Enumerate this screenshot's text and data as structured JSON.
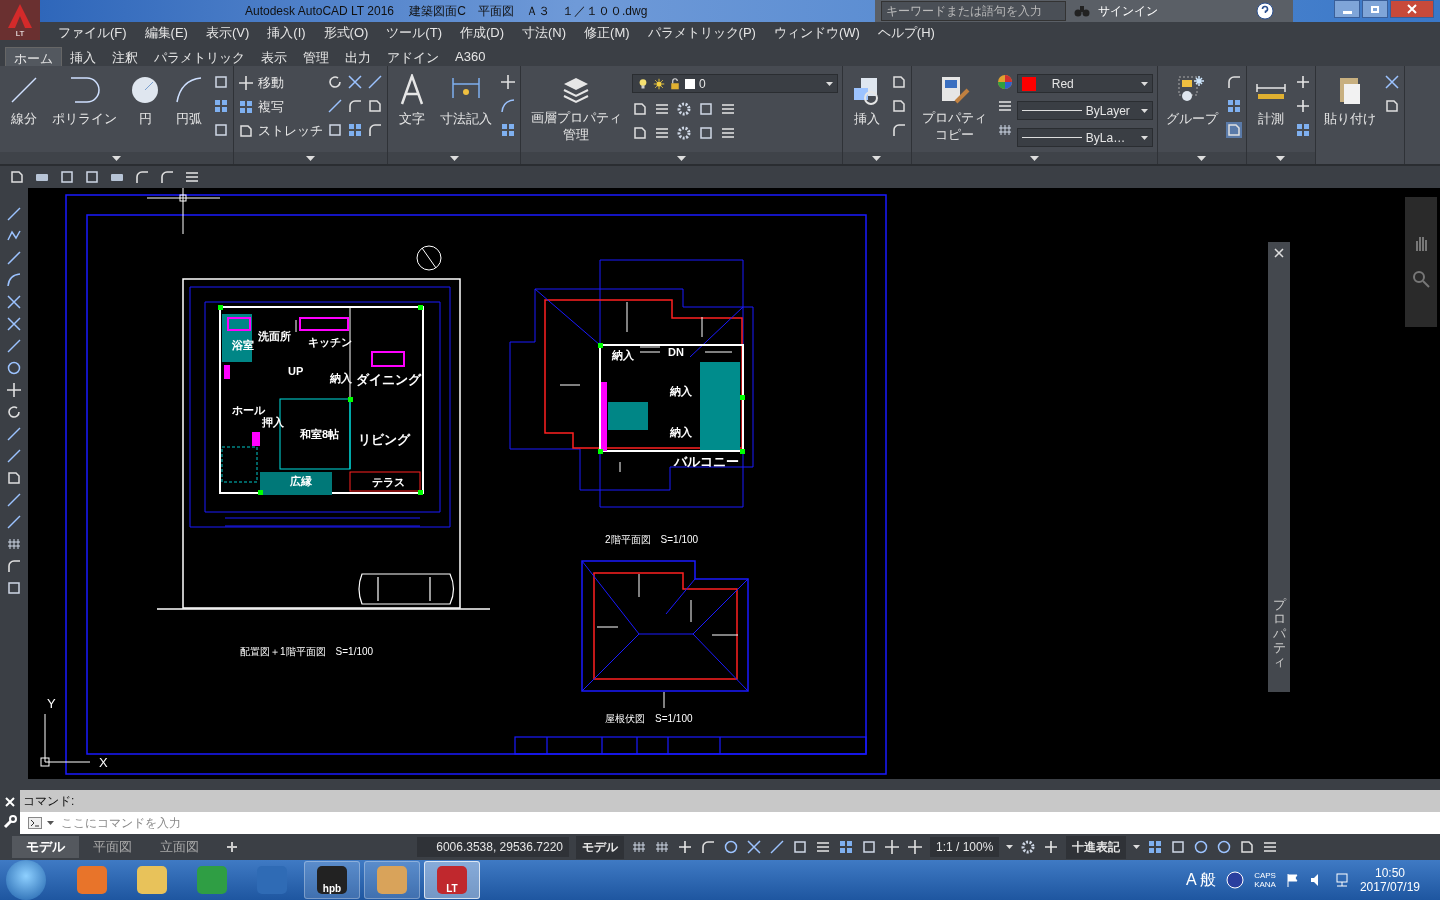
{
  "window": {
    "title": "Autodesk AutoCAD LT 2016　 建築図面C　平面図　Ａ３　１／１００.dwg",
    "app_badge": "LT"
  },
  "search": {
    "placeholder": "キーワードまたは語句を入力"
  },
  "sign_in": "サインイン",
  "menus": [
    "ファイル(F)",
    "編集(E)",
    "表示(V)",
    "挿入(I)",
    "形式(O)",
    "ツール(T)",
    "作成(D)",
    "寸法(N)",
    "修正(M)",
    "パラメトリック(P)",
    "ウィンドウ(W)",
    "ヘルプ(H)"
  ],
  "ribbon_tabs": [
    {
      "label": "ホーム",
      "selected": true
    },
    {
      "label": "挿入",
      "selected": false
    },
    {
      "label": "注釈",
      "selected": false
    },
    {
      "label": "パラメトリック",
      "selected": false
    },
    {
      "label": "表示",
      "selected": false
    },
    {
      "label": "管理",
      "selected": false
    },
    {
      "label": "出力",
      "selected": false
    },
    {
      "label": "アドイン",
      "selected": false
    },
    {
      "label": "A360",
      "selected": false
    }
  ],
  "ribbon": {
    "draw_tools": [
      "線分",
      "ポリライン",
      "円",
      "円弧"
    ],
    "modify_tools": [
      "移動",
      "複写",
      "ストレッチ"
    ],
    "annotation_tools": [
      "文字",
      "寸法記入"
    ],
    "layer_tool": "画層プロパティ管理",
    "current_layer": "0",
    "block_tool": "挿入",
    "match_tool": "プロパティコピー",
    "color": {
      "label": "Red",
      "color": "#ff0000"
    },
    "linetype": "ByLayer",
    "lineweight": "ByLa…",
    "group_tool": "グループ",
    "measure_tool": "計測",
    "paste_tool": "貼り付け"
  },
  "drawing": {
    "site_plan": {
      "title": "配置図＋1階平面図　S=1/100",
      "rooms": [
        "浴室",
        "洗面所",
        "キッチン",
        "ダイニング",
        "UP",
        "納入",
        "ホール",
        "押入",
        "和室8帖",
        "リビング",
        "広縁",
        "テラス"
      ]
    },
    "second_floor": {
      "title": "2階平面図　S=1/100",
      "rooms": [
        "納入",
        "DN",
        "納入",
        "納入",
        "バルコニー"
      ]
    },
    "roof_plan": {
      "title": "屋根伏図　S=1/100"
    },
    "ucs": {
      "y_label": "Y",
      "x_label": "X"
    }
  },
  "properties_palette": {
    "title": "プロパティ"
  },
  "command": {
    "prompt": "コマンド:",
    "placeholder": "ここにコマンドを入力"
  },
  "layout_tabs": [
    {
      "label": "モデル",
      "selected": true
    },
    {
      "label": "平面図",
      "selected": false
    },
    {
      "label": "立面図",
      "selected": false
    }
  ],
  "status_bar": {
    "coordinates": "6006.3538, 29536.7220",
    "space": "モデル",
    "scale": "1:1 / 100%",
    "units": "十進表記"
  },
  "taskbar": {
    "apps": [
      {
        "kind": "media",
        "running": false,
        "selected": false
      },
      {
        "kind": "folder",
        "running": false,
        "selected": false
      },
      {
        "kind": "browser",
        "running": false,
        "selected": false
      },
      {
        "kind": "mail",
        "running": false,
        "selected": false
      },
      {
        "kind": "hpb",
        "badge": "hpb",
        "running": true,
        "selected": false
      },
      {
        "kind": "paint",
        "running": true,
        "selected": false
      },
      {
        "kind": "autocad",
        "badge": "LT",
        "running": true,
        "selected": true
      }
    ],
    "ime_mode": "A",
    "ime_input": "般",
    "caps": "CAPS",
    "kana": "KANA",
    "time": "10:50",
    "date": "2017/07/19"
  }
}
